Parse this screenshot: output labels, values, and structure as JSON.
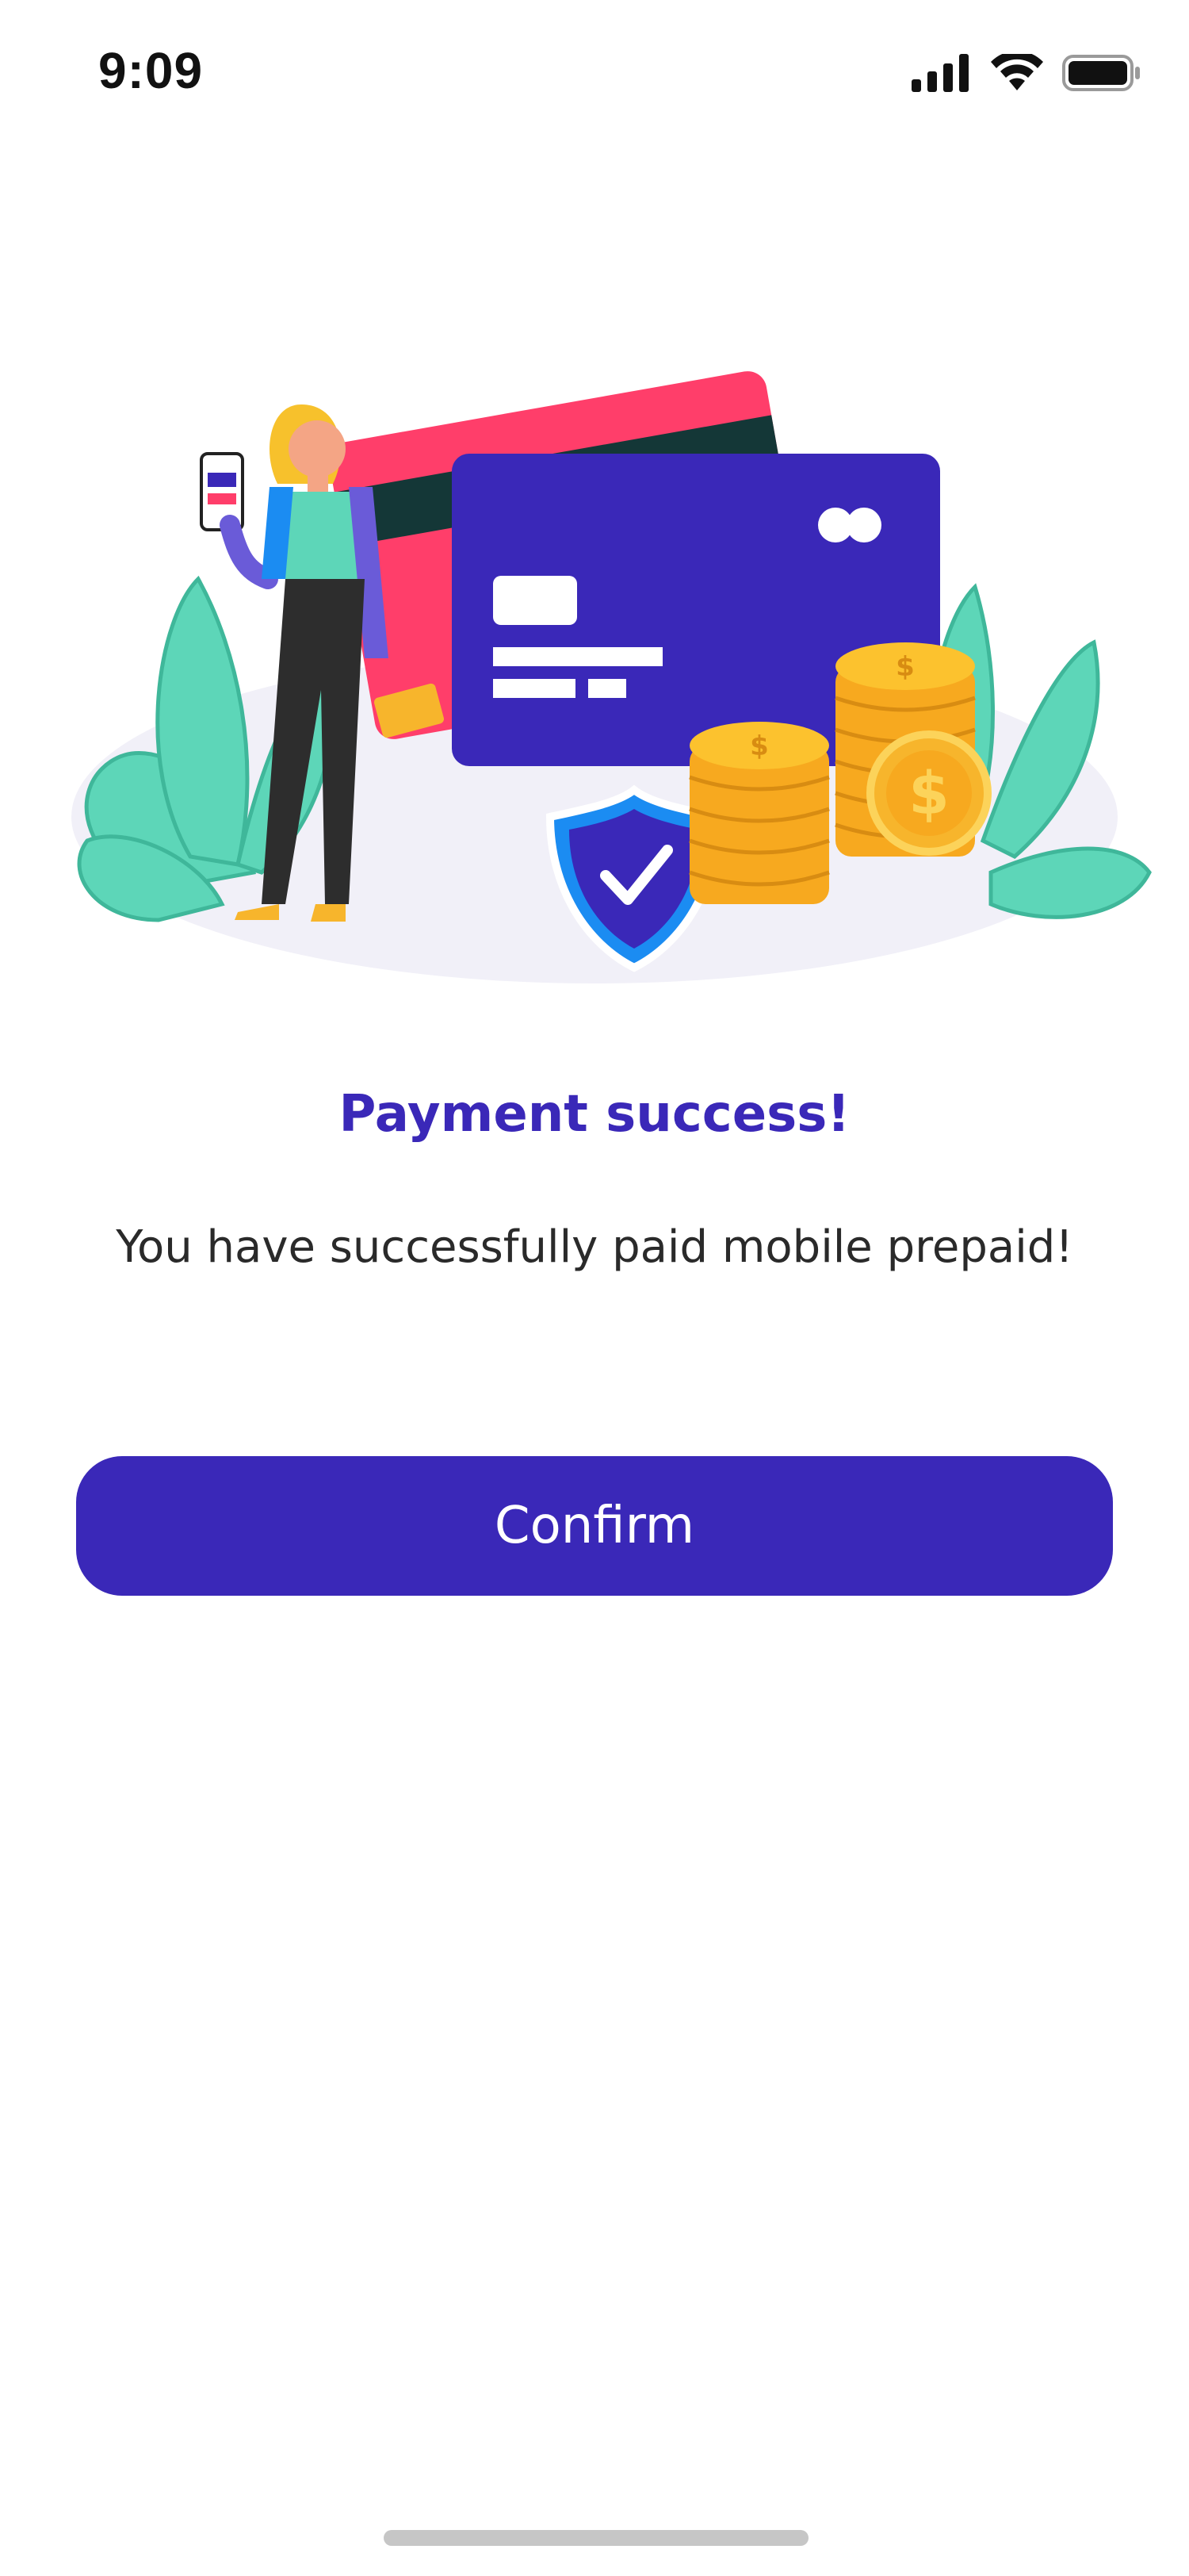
{
  "status_bar": {
    "time": "9:09",
    "icons": [
      "cellular-signal-icon",
      "wifi-icon",
      "battery-icon"
    ]
  },
  "illustration": {
    "name": "payment-illustration"
  },
  "content": {
    "title": "Payment success!",
    "message": "You have successfully paid mobile prepaid!"
  },
  "actions": {
    "confirm_label": "Confirm"
  },
  "colors": {
    "accent": "#3a28b8",
    "title": "#3a28b8",
    "text": "#2a2a2a",
    "card_blue": "#3a28b8",
    "card_red": "#ff3e6a",
    "card_dark": "#143737",
    "leaf": "#5dd6b8",
    "coin": "#f7b52c",
    "shield_outer": "#1b8cf2"
  }
}
